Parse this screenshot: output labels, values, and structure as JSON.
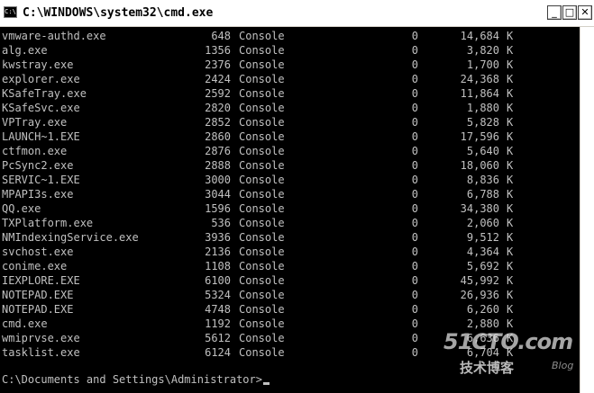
{
  "window": {
    "title": "C:\\WINDOWS\\system32\\cmd.exe",
    "icon_label": "C:\\",
    "controls": {
      "minimize": "_",
      "maximize": "□",
      "close": "✕"
    }
  },
  "tasks": [
    {
      "name": "vmware-authd.exe",
      "pid": "648",
      "session": "Console",
      "num": "0",
      "mem": "14,684",
      "unit": "K"
    },
    {
      "name": "alg.exe",
      "pid": "1356",
      "session": "Console",
      "num": "0",
      "mem": "3,820",
      "unit": "K"
    },
    {
      "name": "kwstray.exe",
      "pid": "2376",
      "session": "Console",
      "num": "0",
      "mem": "1,700",
      "unit": "K"
    },
    {
      "name": "explorer.exe",
      "pid": "2424",
      "session": "Console",
      "num": "0",
      "mem": "24,368",
      "unit": "K"
    },
    {
      "name": "KSafeTray.exe",
      "pid": "2592",
      "session": "Console",
      "num": "0",
      "mem": "11,864",
      "unit": "K"
    },
    {
      "name": "KSafeSvc.exe",
      "pid": "2820",
      "session": "Console",
      "num": "0",
      "mem": "1,880",
      "unit": "K"
    },
    {
      "name": "VPTray.exe",
      "pid": "2852",
      "session": "Console",
      "num": "0",
      "mem": "5,828",
      "unit": "K"
    },
    {
      "name": "LAUNCH~1.EXE",
      "pid": "2860",
      "session": "Console",
      "num": "0",
      "mem": "17,596",
      "unit": "K"
    },
    {
      "name": "ctfmon.exe",
      "pid": "2876",
      "session": "Console",
      "num": "0",
      "mem": "5,640",
      "unit": "K"
    },
    {
      "name": "PcSync2.exe",
      "pid": "2888",
      "session": "Console",
      "num": "0",
      "mem": "18,060",
      "unit": "K"
    },
    {
      "name": "SERVIC~1.EXE",
      "pid": "3000",
      "session": "Console",
      "num": "0",
      "mem": "8,836",
      "unit": "K"
    },
    {
      "name": "MPAPI3s.exe",
      "pid": "3044",
      "session": "Console",
      "num": "0",
      "mem": "6,788",
      "unit": "K"
    },
    {
      "name": "QQ.exe",
      "pid": "1596",
      "session": "Console",
      "num": "0",
      "mem": "34,380",
      "unit": "K"
    },
    {
      "name": "TXPlatform.exe",
      "pid": "536",
      "session": "Console",
      "num": "0",
      "mem": "2,060",
      "unit": "K"
    },
    {
      "name": "NMIndexingService.exe",
      "pid": "3936",
      "session": "Console",
      "num": "0",
      "mem": "9,512",
      "unit": "K"
    },
    {
      "name": "svchost.exe",
      "pid": "2136",
      "session": "Console",
      "num": "0",
      "mem": "4,364",
      "unit": "K"
    },
    {
      "name": "conime.exe",
      "pid": "1108",
      "session": "Console",
      "num": "0",
      "mem": "5,692",
      "unit": "K"
    },
    {
      "name": "IEXPLORE.EXE",
      "pid": "6100",
      "session": "Console",
      "num": "0",
      "mem": "45,992",
      "unit": "K"
    },
    {
      "name": "NOTEPAD.EXE",
      "pid": "5324",
      "session": "Console",
      "num": "0",
      "mem": "26,936",
      "unit": "K"
    },
    {
      "name": "NOTEPAD.EXE",
      "pid": "4748",
      "session": "Console",
      "num": "0",
      "mem": "6,260",
      "unit": "K"
    },
    {
      "name": "cmd.exe",
      "pid": "1192",
      "session": "Console",
      "num": "0",
      "mem": "2,880",
      "unit": "K"
    },
    {
      "name": "wmiprvse.exe",
      "pid": "5612",
      "session": "Console",
      "num": "0",
      "mem": "6,636",
      "unit": "K"
    },
    {
      "name": "tasklist.exe",
      "pid": "6124",
      "session": "Console",
      "num": "0",
      "mem": "6,704",
      "unit": "K"
    }
  ],
  "prompt": "C:\\Documents and Settings\\Administrator>",
  "watermark": {
    "main": "51CTO.com",
    "sub": "技术博客",
    "tag": "Blog"
  }
}
